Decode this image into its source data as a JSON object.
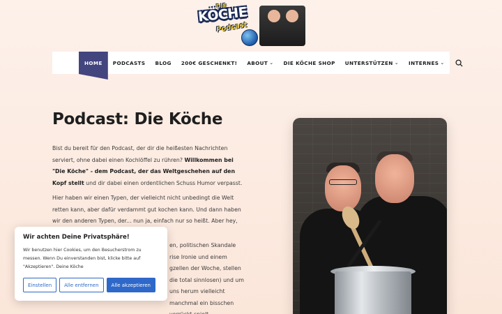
{
  "logo": {
    "die": "DIE",
    "name": "KÖCHE",
    "podcast": "Podcast"
  },
  "nav": {
    "items": [
      {
        "label": "HOME",
        "active": true
      },
      {
        "label": "PODCASTS"
      },
      {
        "label": "BLOG"
      },
      {
        "label": "200€ GESCHENKT!"
      },
      {
        "label": "ABOUT",
        "dropdown": true
      },
      {
        "label": "DIE KÖCHE SHOP"
      },
      {
        "label": "UNTERSTÜTZEN",
        "dropdown": true
      },
      {
        "label": "INTERNES",
        "dropdown": true
      }
    ],
    "search_icon": "search-icon"
  },
  "main": {
    "title": "Podcast: Die Köche",
    "p1_a": "Bist du bereit für den Podcast, der dir die heißesten Nachrichten serviert, ohne dabei einen Kochlöffel zu rühren? ",
    "p1_b": "Willkommen bei \"Die Köche\" - dem Podcast, der das Weltgeschehen auf den Kopf stellt",
    "p1_c": " und dir dabei einen ordentlichen Schuss Humor verpasst.",
    "p2": "Hier haben wir einen Typen, der vielleicht nicht unbedingt die Welt retten kann, aber dafür verdammt gut kochen kann. Und dann haben wir den anderen Typen, der... nun ja, einfach nur so heißt. Aber hey, er?",
    "p3": "en, politischen Skandale rise Ironie und einem gzellen der Woche, stellen die total sinnlosen) und um uns herum vielleicht manchmal ein bisschen verrückt spielt."
  },
  "cookie": {
    "title": "Wir achten Deine Privatsphäre!",
    "text": "Wir benutzen hier Cookies, um den Besucherstrom zu messen. Wenn Du einverstanden bist, klicke bitte auf \"Akzeptieren\". Deine Köche",
    "btn_settings": "Einstellen",
    "btn_reject": "Alle entfernen",
    "btn_accept": "Alle akzeptieren"
  },
  "colors": {
    "nav_active": "#43457e",
    "accent_blue": "#2e68c8"
  }
}
